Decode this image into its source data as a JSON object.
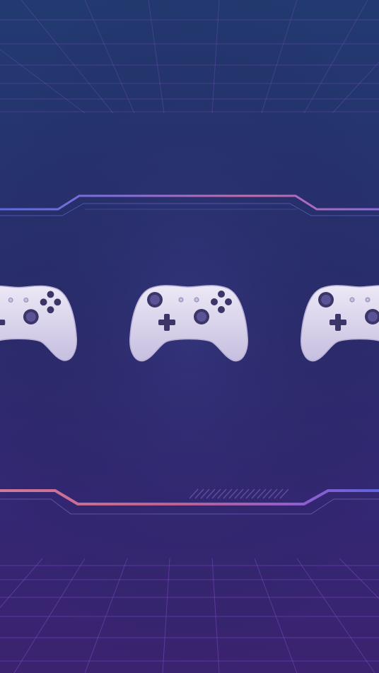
{
  "scene": {
    "title": "",
    "theme": "retro-synthwave gaming wallpaper",
    "colors": {
      "top": "#223a70",
      "middle": "#2b2a6c",
      "bottom": "#3b2370",
      "grid": "#7a4fd0",
      "frame_blue": "#5f6ee0",
      "frame_pink": "#c86aa8",
      "controller": "#e6e2f0",
      "controller_shadow": "#b9b2d3",
      "button_dark": "#3a3466"
    },
    "controllers": [
      {
        "name": "controller-left",
        "icon": "gamepad-icon"
      },
      {
        "name": "controller-center",
        "icon": "gamepad-icon"
      },
      {
        "name": "controller-right",
        "icon": "gamepad-icon"
      }
    ]
  }
}
